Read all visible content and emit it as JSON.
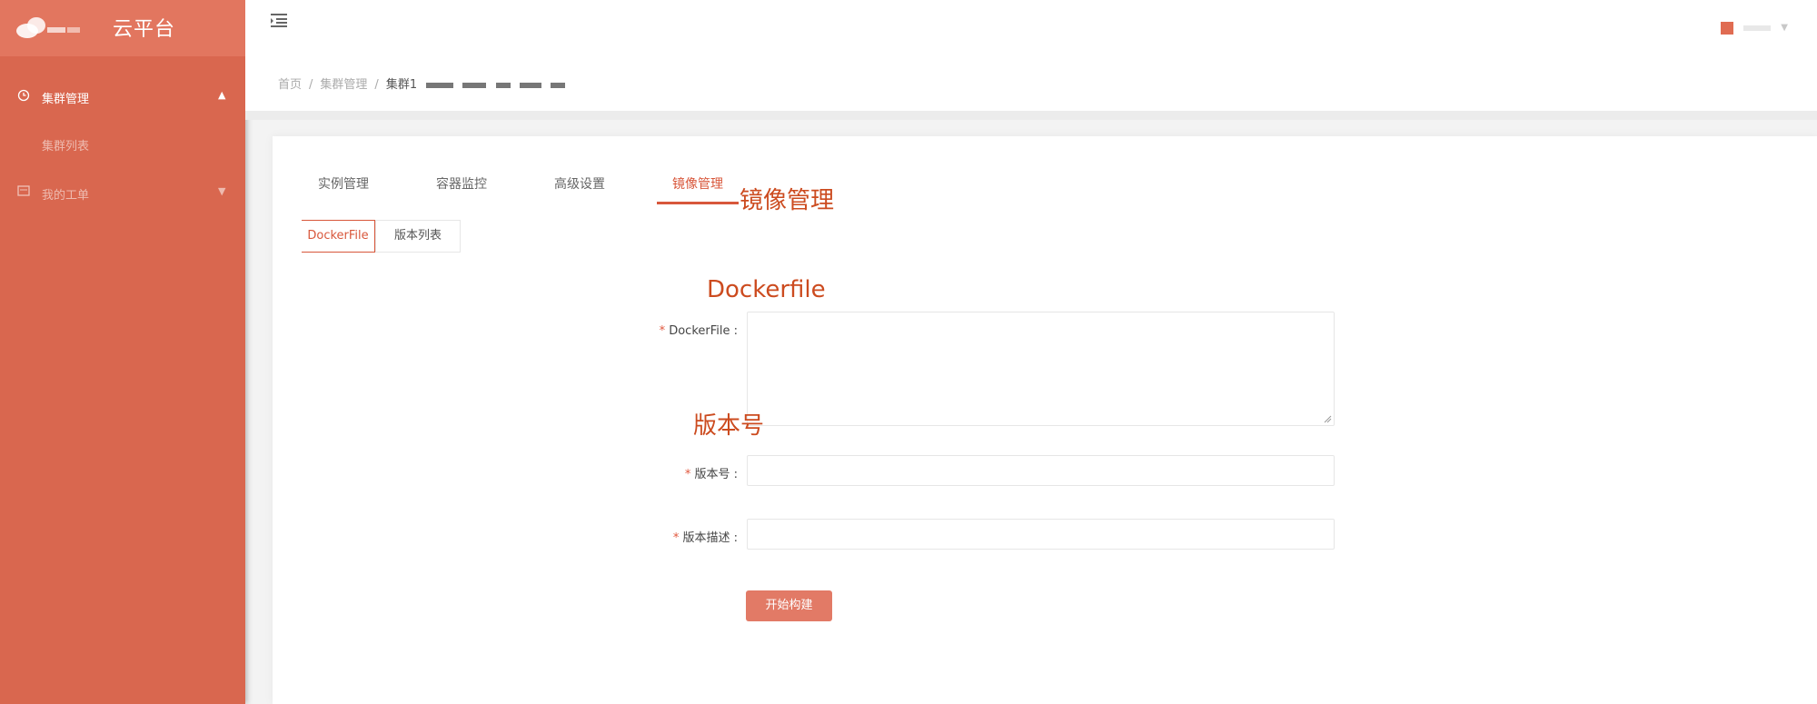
{
  "app": {
    "title": "云平台",
    "brand_color": "#d9674f",
    "accent_color": "#d8573b"
  },
  "sidebar": {
    "groups": [
      {
        "label": "集群管理",
        "icon": "cluster-icon",
        "expanded": true,
        "items": [
          {
            "label": "集群列表"
          }
        ]
      },
      {
        "label": "我的工单",
        "icon": "ticket-icon",
        "expanded": false
      }
    ]
  },
  "header": {
    "breadcrumb": [
      "首页",
      "集群管理",
      "集群1"
    ]
  },
  "tabs": [
    {
      "label": "实例管理",
      "active": false
    },
    {
      "label": "容器监控",
      "active": false
    },
    {
      "label": "高级设置",
      "active": false
    },
    {
      "label": "镜像管理",
      "active": true
    }
  ],
  "subtabs": [
    {
      "label": "DockerFile",
      "active": true
    },
    {
      "label": "版本列表",
      "active": false
    }
  ],
  "annotations": {
    "image_mgmt": "镜像管理",
    "dockerfile": "Dockerfile",
    "version": "版本号"
  },
  "form": {
    "dockerfile_label": "DockerFile :",
    "dockerfile_value": "",
    "version_label": "版本号 :",
    "version_value": "",
    "description_label": "版本描述 :",
    "description_value": "",
    "required_mark": "*",
    "submit_label": "开始构建"
  }
}
